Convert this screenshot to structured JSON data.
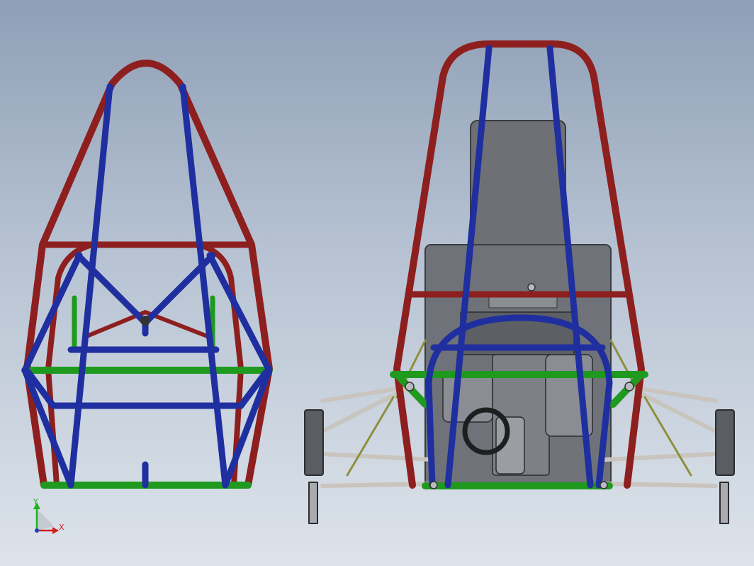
{
  "viewport": {
    "background_top": "#8f9fb6",
    "background_bottom": "#dde3ea"
  },
  "colors": {
    "main_hoop": "#8e1f1f",
    "brace_blue": "#1f2fa0",
    "side_green": "#1f9a1f",
    "suspension_arm": "#c9c4bd",
    "drivetrain_grey": "#6f7379",
    "olive_link": "#8f8f3c"
  },
  "views": [
    {
      "name": "front-view",
      "description_icon": "roll-cage-front-icon"
    },
    {
      "name": "rear-view",
      "description_icon": "chassis-rear-with-engine-icon"
    }
  ],
  "axis_triad": {
    "y_label": "Y",
    "x_label": "X",
    "y_color": "#1fb31f",
    "x_color": "#d02020",
    "z_color": "#2040c0"
  }
}
